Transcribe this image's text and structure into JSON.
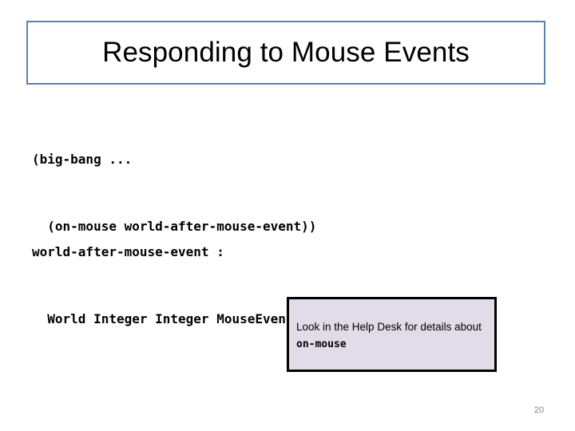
{
  "slide": {
    "background_color": "#FFFFFF",
    "title": {
      "text": "Responding to Mouse Events",
      "border_color": "#5B82AB",
      "text_color": "#000000"
    },
    "code_blocks": [
      {
        "lines": [
          "(big-bang ...",
          "  (on-mouse world-after-mouse-event))"
        ]
      },
      {
        "lines": [
          "world-after-mouse-event :",
          "  World Integer Integer MouseEvent -> World"
        ]
      }
    ],
    "callout": {
      "text_before": "Look in the Help Desk for details about ",
      "text_code": "on-mouse",
      "fill_color": "#E1DCE8",
      "border_color": "#000000"
    },
    "page_number": "20"
  }
}
